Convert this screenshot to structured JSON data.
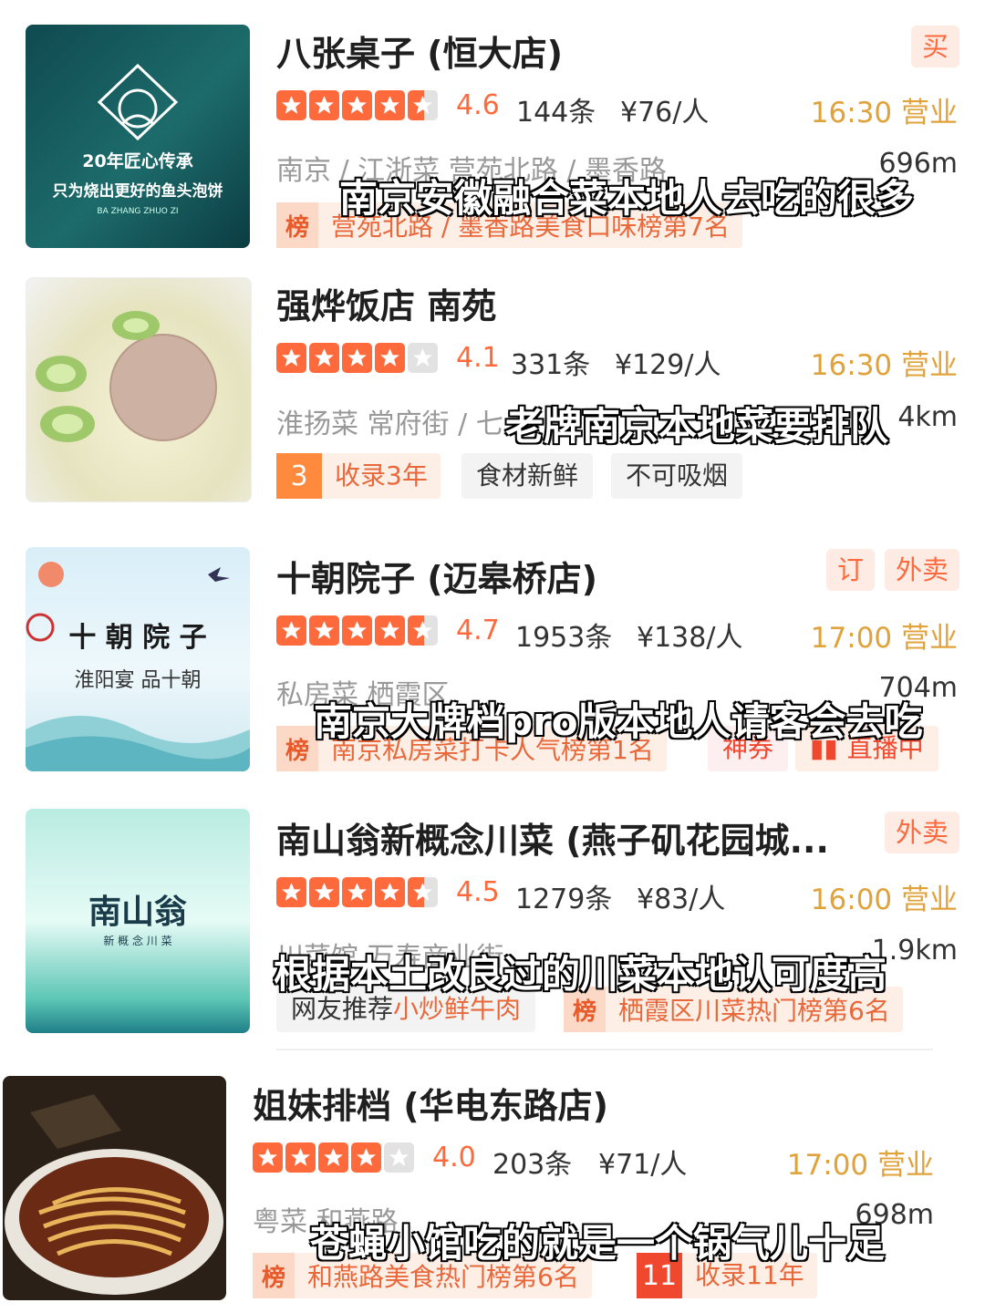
{
  "restaurants": [
    {
      "name": "八张桌子 (恒大店)",
      "rating": "4.6",
      "reviews": "144条",
      "price": "¥76/人",
      "hours": "16:30 营业",
      "location": "南京 / 江浙菜 营苑北路 / 墨香路",
      "distance": "696m",
      "corner_badges": [
        "买"
      ],
      "rank_text": "营苑北路 / 墨香路美食口味榜第7名",
      "subtitle": "南京安徽融合菜本地人去吃的很多",
      "thumb_text": {
        "line1": "20年匠心传承",
        "line2": "只为烧出更好的鱼头泡饼",
        "line3": "BA ZHANG ZHUO ZI"
      }
    },
    {
      "name": "强烨饭店 南苑",
      "rating": "4.1",
      "reviews": "331条",
      "price": "¥129/人",
      "hours": "16:30 营业",
      "location": "淮扬菜 常府街 / 七",
      "distance": "4km",
      "badge_num": "3",
      "badge_num_text": "收录3年",
      "chips": [
        "食材新鲜",
        "不可吸烟"
      ],
      "subtitle": "老牌南京本地菜要排队"
    },
    {
      "name": "十朝院子 (迈皋桥店)",
      "rating": "4.7",
      "reviews": "1953条",
      "price": "¥138/人",
      "hours": "17:00 营业",
      "location": "私房菜 栖霞区",
      "distance": "704m",
      "corner_badges": [
        "订",
        "外卖"
      ],
      "rank_text": "南京私房菜打卡人气榜第1名",
      "extra_chips": [
        "神券",
        "直播中"
      ],
      "subtitle": "南京大牌档pro版本地人请客会去吃",
      "thumb_text": {
        "line1": "十 朝 院 子",
        "line2": "淮阳宴 品十朝"
      }
    },
    {
      "name": "南山翁新概念川菜 (燕子矶花园城...",
      "rating": "4.5",
      "reviews": "1279条",
      "price": "¥83/人",
      "hours": "16:00 营业",
      "location": "川菜馆 万寿商业街",
      "distance": "1.9km",
      "corner_badges": [
        "外卖"
      ],
      "recommend_prefix": "网友推荐",
      "recommend_dish": "小炒鲜牛肉",
      "rank_text": "栖霞区川菜热门榜第6名",
      "subtitle": "根据本土改良过的川菜本地认可度高",
      "thumb_text": {
        "line1": "南山翁",
        "line2": "新 概 念 川 菜"
      }
    },
    {
      "name": "姐妹排档 (华电东路店)",
      "rating": "4.0",
      "reviews": "203条",
      "price": "¥71/人",
      "hours": "17:00 营业",
      "location": "粤菜 和燕路",
      "distance": "698m",
      "rank_text": "和燕路美食热门榜第6名",
      "badge_num": "11",
      "badge_num_text": "收录11年",
      "subtitle": "苍蝇小馆吃的就是一个锅气儿十足"
    }
  ],
  "rank_icon": "榜",
  "colors": {
    "accent": "#ff6a3d",
    "hours": "#e0a23b",
    "rank_bg": "#fdeee6"
  }
}
